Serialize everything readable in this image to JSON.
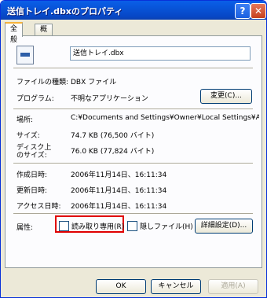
{
  "window": {
    "title": "送信トレイ.dbxのプロパティ",
    "help": "?",
    "close": "✕"
  },
  "tabs": [
    {
      "label": "全般"
    },
    {
      "label": "概要"
    }
  ],
  "general": {
    "file_name": "送信トレイ.dbx",
    "rows": {
      "file_type_label": "ファイルの種類:",
      "file_type_value": "DBX ファイル",
      "program_label": "プログラム:",
      "program_value": "不明なアプリケーション",
      "change_button": "変更(C)...",
      "location_label": "場所:",
      "location_value": "C:¥Documents and Settings¥Owner¥Local Settings¥Appl",
      "size_label": "サイズ:",
      "size_value": "74.7 KB (76,500 バイト)",
      "disk_size_label_1": "ディスク上",
      "disk_size_label_2": "のサイズ:",
      "disk_size_value": "76.0 KB (77,824 バイト)",
      "created_label": "作成日時:",
      "created_value": "2006年11月14日、16:11:34",
      "modified_label": "更新日時:",
      "modified_value": "2006年11月14日、16:11:34",
      "accessed_label": "アクセス日時:",
      "accessed_value": "2006年11月14日、16:11:34",
      "attributes_label": "属性:",
      "readonly_label": "読み取り専用(R)",
      "hidden_label": "隠しファイル(H)",
      "advanced_button": "詳細設定(D)..."
    }
  },
  "footer": {
    "ok": "OK",
    "cancel": "キャンセル",
    "apply": "適用(A)"
  }
}
